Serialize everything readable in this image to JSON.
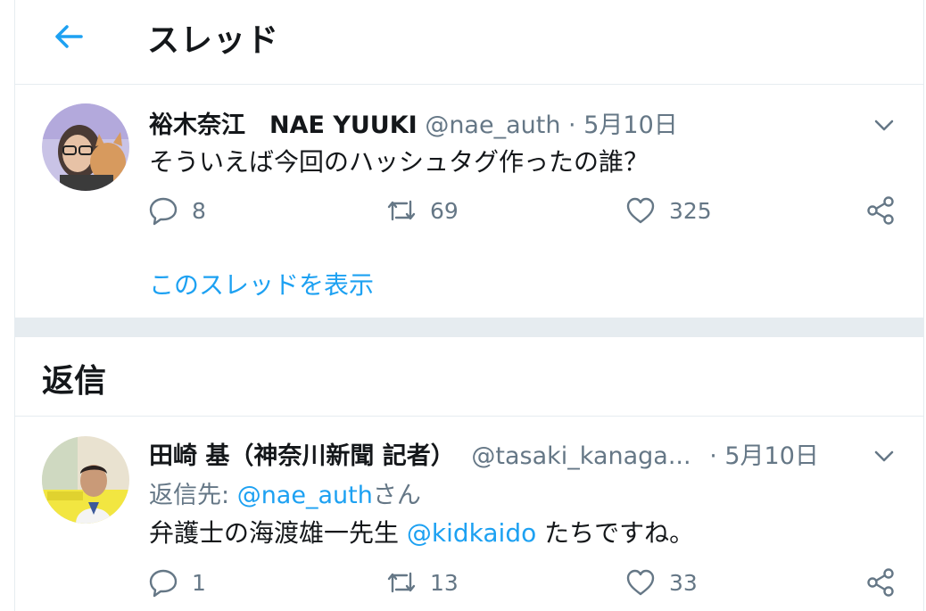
{
  "header": {
    "title": "スレッド"
  },
  "main_tweet": {
    "display_name": "裕木奈江　NAE YUUKI",
    "handle": "@nae_auth",
    "separator": "·",
    "date": "5月10日",
    "text": "そういえば今回のハッシュタグ作ったの誰？",
    "replies": "8",
    "retweets": "69",
    "likes": "325",
    "show_thread": "このスレッドを表示"
  },
  "replies_section": {
    "title": "返信"
  },
  "reply_tweet": {
    "display_name": "田崎 基（神奈川新聞 記者）",
    "handle": "@tasaki_kanaga...",
    "separator": "·",
    "date": "5月10日",
    "reply_to_label": "返信先: ",
    "reply_to_handle": "@nae_auth",
    "reply_to_suffix": "さん",
    "text_before": "弁護士の海渡雄一先生 ",
    "mention": "@kidkaido",
    "text_after": " たちですね。",
    "replies": "1",
    "retweets": "13",
    "likes": "33"
  },
  "colors": {
    "accent": "#1da1f2",
    "muted": "#657786",
    "divider": "#e6ecf0"
  },
  "icons": [
    "arrow-left-icon",
    "chevron-down-icon",
    "reply-icon",
    "retweet-icon",
    "heart-icon",
    "share-icon"
  ]
}
